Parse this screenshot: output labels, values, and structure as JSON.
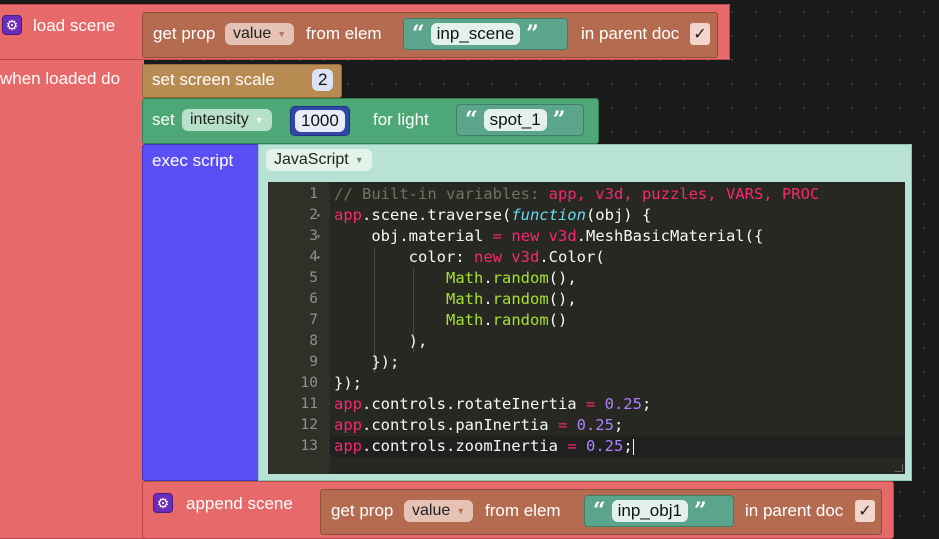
{
  "load_scene": {
    "label": "load scene",
    "when_loaded_label": "when loaded do"
  },
  "get_prop_1": {
    "label": "get prop",
    "prop_value": "value",
    "from_label": "from elem",
    "elem_value": "inp_scene",
    "parent_label": "in parent doc",
    "checked_mark": "✓"
  },
  "set_screen_scale": {
    "label": "set screen scale",
    "value": "2"
  },
  "set_intensity": {
    "label": "set",
    "prop": "intensity",
    "value": "1000",
    "for_label": "for light",
    "light": "spot_1"
  },
  "exec_script": {
    "label": "exec script",
    "language": "JavaScript",
    "line_numbers": [
      "1",
      "2",
      "3",
      "4",
      "5",
      "6",
      "7",
      "8",
      "9",
      "10",
      "11",
      "12",
      "13"
    ],
    "code": {
      "l1_comment": "// Built-in variables: ",
      "l1_vars": "app, v3d, puzzles, VARS, PROC",
      "l2_app": "app",
      "l2_rest": ".scene.traverse(",
      "l2_fn": "function",
      "l2_tail": "(obj) {",
      "l3_a": "    obj.material ",
      "l3_eq": "=",
      "l3_new": " new ",
      "l3_v3d": "v3d",
      "l3_dot": ".",
      "l3_cls": "MeshBasicMaterial",
      "l3_tail": "({",
      "l4_a": "        color: ",
      "l4_new": "new ",
      "l4_v3d": "v3d",
      "l4_dot": ".",
      "l4_cls": "Color",
      "l4_tail": "(",
      "l5_math": "            Math",
      "l5_dot": ".",
      "l5_fn": "random",
      "l5_tail": "(),",
      "l6_math": "            Math",
      "l6_dot": ".",
      "l6_fn": "random",
      "l6_tail": "(),",
      "l7_math": "            Math",
      "l7_dot": ".",
      "l7_fn": "random",
      "l7_tail": "()",
      "l8": "        ),",
      "l9": "    });",
      "l10": "});",
      "l11_app": "app",
      "l11_rest": ".controls.rotateInertia ",
      "l11_eq": "=",
      "l11_num": " 0.25",
      "l11_tail": ";",
      "l12_app": "app",
      "l12_rest": ".controls.panInertia ",
      "l12_eq": "=",
      "l12_num": " 0.25",
      "l12_tail": ";",
      "l13_app": "app",
      "l13_rest": ".controls.zoomInertia ",
      "l13_eq": "=",
      "l13_num": " 0.25",
      "l13_tail": ";"
    }
  },
  "append_scene": {
    "label": "append scene"
  },
  "get_prop_2": {
    "label": "get prop",
    "prop_value": "value",
    "from_label": "from elem",
    "elem_value": "inp_obj1",
    "parent_label": "in parent doc",
    "checked_mark": "✓"
  },
  "icons": {
    "gear": "gear-icon",
    "dropdown": "chevron-down-icon",
    "quote_open": "“",
    "quote_close": "”"
  },
  "colors": {
    "scene_block": "#e8696a",
    "prop_block": "#b46b50",
    "screen_block": "#b88b52",
    "light_block": "#4ea776",
    "exec_block": "#5a4ff5",
    "editor_bg": "#272822"
  }
}
